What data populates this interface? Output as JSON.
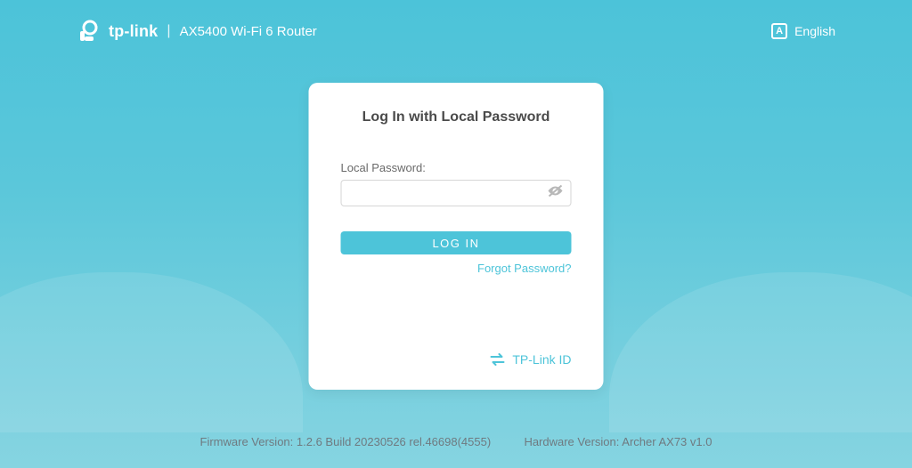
{
  "header": {
    "brand": "tp-link",
    "model": "AX5400 Wi-Fi 6 Router",
    "language_label": "English"
  },
  "login": {
    "title": "Log In with Local Password",
    "password_label": "Local Password:",
    "password_value": "",
    "submit_label": "LOG IN",
    "forgot_label": "Forgot Password?",
    "tplink_id_label": "TP-Link ID"
  },
  "footer": {
    "firmware_label": "Firmware Version:",
    "firmware_value": "1.2.6 Build 20230526 rel.46698(4555)",
    "hardware_label": "Hardware Version:",
    "hardware_value": "Archer AX73 v1.0"
  },
  "colors": {
    "accent": "#4dc4d9"
  }
}
